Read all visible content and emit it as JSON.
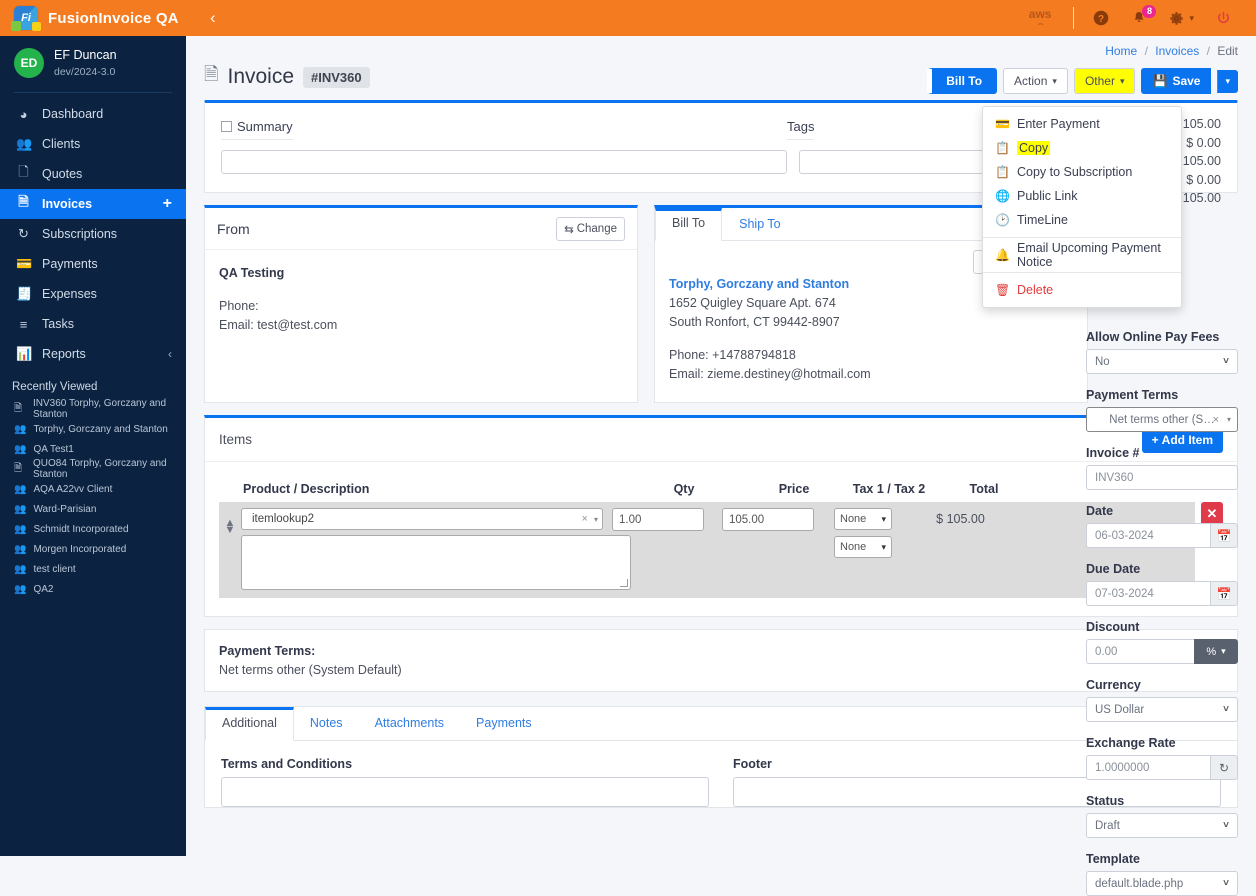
{
  "app": {
    "brand": "FusionInvoice QA",
    "logo_text": "Fi",
    "collapse_icon": "chevron-left-icon",
    "aws_label": "aws",
    "header_icons": [
      {
        "name": "help-icon",
        "glyph": "?"
      },
      {
        "name": "notifications-icon",
        "glyph": "bell",
        "badge": "8"
      },
      {
        "name": "settings-icon",
        "glyph": "gear"
      },
      {
        "name": "power-icon",
        "glyph": "power"
      }
    ]
  },
  "user": {
    "initials": "ED",
    "name": "EF Duncan",
    "version": "dev/2024-3.0"
  },
  "sidebar": {
    "items": [
      {
        "label": "Dashboard",
        "icon": "dashboard-icon",
        "active": false
      },
      {
        "label": "Clients",
        "icon": "clients-icon",
        "active": false
      },
      {
        "label": "Quotes",
        "icon": "quotes-icon",
        "active": false
      },
      {
        "label": "Invoices",
        "icon": "invoices-icon",
        "active": true,
        "plus": "+"
      },
      {
        "label": "Subscriptions",
        "icon": "subscriptions-icon",
        "active": false
      },
      {
        "label": "Payments",
        "icon": "payments-icon",
        "active": false
      },
      {
        "label": "Expenses",
        "icon": "expenses-icon",
        "active": false
      },
      {
        "label": "Tasks",
        "icon": "tasks-icon",
        "active": false
      },
      {
        "label": "Reports",
        "icon": "reports-icon",
        "active": false,
        "chevron": "‹"
      }
    ],
    "recently_viewed_title": "Recently Viewed",
    "recently_viewed": [
      {
        "label": "INV360 Torphy, Gorczany and Stanton",
        "icon": "document-icon"
      },
      {
        "label": "Torphy, Gorczany and Stanton",
        "icon": "clients-icon"
      },
      {
        "label": "QA Test1",
        "icon": "clients-icon"
      },
      {
        "label": "QUO84 Torphy, Gorczany and Stanton",
        "icon": "document-icon"
      },
      {
        "label": "AQA A22vv Client",
        "icon": "clients-icon"
      },
      {
        "label": "Ward-Parisian",
        "icon": "clients-icon"
      },
      {
        "label": "Schmidt Incorporated",
        "icon": "clients-icon"
      },
      {
        "label": "Morgen Incorporated",
        "icon": "clients-icon"
      },
      {
        "label": "test client",
        "icon": "clients-icon"
      },
      {
        "label": "QA2",
        "icon": "clients-icon"
      }
    ]
  },
  "breadcrumb": {
    "home": "Home",
    "invoices": "Invoices",
    "current": "Edit",
    "sep": "/"
  },
  "page": {
    "title": "Invoice",
    "invoice_pill": "#INV360"
  },
  "actions": {
    "bill_to": "Bill To",
    "action": "Action",
    "other": "Other",
    "save": "Save"
  },
  "other_menu": {
    "items": [
      {
        "label": "Enter Payment",
        "icon": "credit-card-icon",
        "highlight": false,
        "danger": false
      },
      {
        "label": "Copy",
        "icon": "copy-icon",
        "highlight": true,
        "danger": false
      },
      {
        "label": "Copy to Subscription",
        "icon": "copy-icon",
        "highlight": false,
        "danger": false
      },
      {
        "label": "Public Link",
        "icon": "globe-icon",
        "highlight": false,
        "danger": false
      },
      {
        "label": "TimeLine",
        "icon": "clock-icon",
        "highlight": false,
        "danger": false
      },
      {
        "label": "Email Upcoming Payment Notice",
        "icon": "bell-icon",
        "highlight": false,
        "danger": false
      },
      {
        "label": "Delete",
        "icon": "trash-icon",
        "highlight": false,
        "danger": true
      }
    ]
  },
  "summary_panel": {
    "summary_label": "Summary",
    "summary_value": "",
    "tags_label": "Tags",
    "tags_value": "",
    "totals": [
      "$ 105.00",
      "$ 0.00",
      "$ 105.00",
      "$ 0.00",
      "$ 105.00"
    ]
  },
  "from": {
    "title": "From",
    "change_label": "Change",
    "change_icon": "swap-icon",
    "name": "QA Testing",
    "phone": "Phone:",
    "email": "Email: test@test.com"
  },
  "bill_to": {
    "tabs": [
      {
        "label": "Bill To",
        "active": true
      },
      {
        "label": "Ship To",
        "active": false
      }
    ],
    "change_label": "Change",
    "name": "Torphy, Gorczany and Stanton",
    "address1": "1652 Quigley Square Apt. 674",
    "address2": "South Ronfort, CT 99442-8907",
    "phone": "Phone: +14788794818",
    "email": "Email: zieme.destiney@hotmail.com"
  },
  "items": {
    "title": "Items",
    "add_item": "Add Item",
    "columns": {
      "product": "Product / Description",
      "qty": "Qty",
      "price": "Price",
      "tax": "Tax 1 / Tax 2",
      "total": "Total"
    },
    "rows": [
      {
        "product": "itemlookup2",
        "description": "",
        "qty": "1.00",
        "price": "105.00",
        "tax1": "None",
        "tax2": "None",
        "total": "$ 105.00",
        "delete_glyph": "✕"
      }
    ]
  },
  "payment_terms_block": {
    "title": "Payment Terms:",
    "value": "Net terms other (System Default)"
  },
  "bottom_tabs": {
    "tabs": [
      {
        "label": "Additional",
        "active": true
      },
      {
        "label": "Notes",
        "active": false
      },
      {
        "label": "Attachments",
        "active": false
      },
      {
        "label": "Payments",
        "active": false
      }
    ],
    "terms_label": "Terms and Conditions",
    "terms_value": "",
    "footer_label": "Footer",
    "footer_value": ""
  },
  "rail": {
    "allow_online_pay_fees": {
      "label": "Allow Online Pay Fees",
      "value": "No"
    },
    "payment_terms": {
      "label": "Payment Terms",
      "value": "Net terms other (S…"
    },
    "invoice_number": {
      "label": "Invoice #",
      "value": "INV360"
    },
    "date": {
      "label": "Date",
      "value": "06-03-2024",
      "icon": "calendar-icon"
    },
    "due_date": {
      "label": "Due Date",
      "value": "07-03-2024",
      "icon": "calendar-icon"
    },
    "discount": {
      "label": "Discount",
      "value": "0.00",
      "addon": "%"
    },
    "currency": {
      "label": "Currency",
      "value": "US Dollar"
    },
    "exchange_rate": {
      "label": "Exchange Rate",
      "value": "1.0000000",
      "icon": "refresh-icon"
    },
    "status": {
      "label": "Status",
      "value": "Draft"
    },
    "template": {
      "label": "Template",
      "value": "default.blade.php"
    }
  },
  "colors": {
    "header_orange": "#f47b20",
    "sidebar_navy": "#0b2341",
    "accent_blue": "#0a74f0",
    "highlight_yellow": "#ffff00",
    "danger_red": "#e03b4a"
  }
}
